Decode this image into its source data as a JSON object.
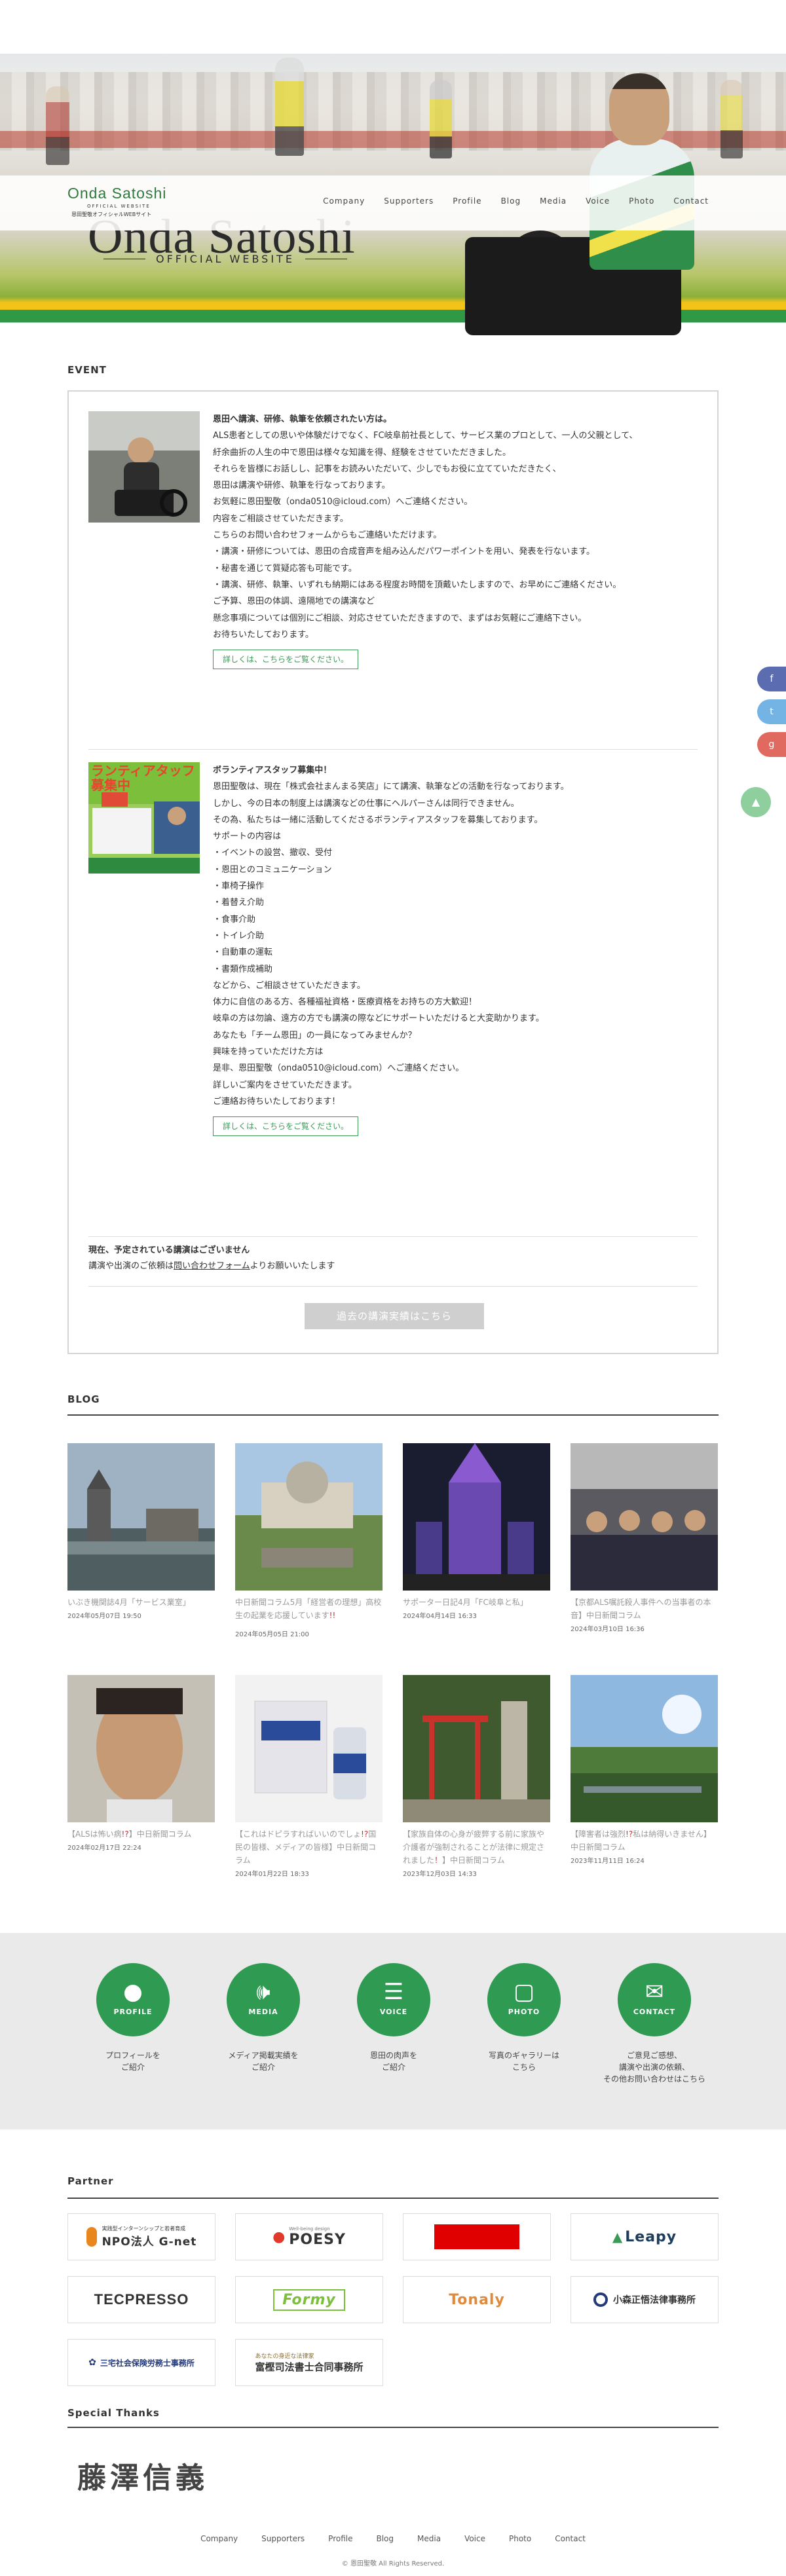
{
  "header": {
    "logo_name": "Onda Satoshi",
    "logo_sub": "OFFICIAL WEBSITE",
    "logo_jp": "恩田聖敬オフィシャルWEBサイト",
    "nav": [
      "Company",
      "Supporters",
      "Profile",
      "Blog",
      "Media",
      "Voice",
      "Photo",
      "Contact"
    ]
  },
  "hero": {
    "title": "Onda Satoshi",
    "subtitle": "OFFICIAL WEBSITE"
  },
  "event": {
    "section_title": "EVENT",
    "item1": {
      "lines": [
        "恩田へ講演、研修、執筆を依頼されたい方は。",
        "ALS患者としての思いや体験だけでなく、FC岐阜前社長として、サービス業のプロとして、一人の父親として、",
        "紆余曲折の人生の中で恩田は様々な知識を得、経験をさせていただきました。",
        "",
        "それらを皆様にお話しし、記事をお読みいただいて、少しでもお役に立てていただきたく、",
        "恩田は講演や研修、執筆を行なっております。",
        "",
        "お気軽に恩田聖敬（onda0510@icloud.com）へご連絡ください。",
        "内容をご相談させていただきます。",
        "こちらのお問い合わせフォームからもご連絡いただけます。",
        "",
        "・講演・研修については、恩田の合成音声を組み込んだパワーポイントを用い、発表を行ないます。",
        "・秘書を通じて質疑応答も可能です。",
        "・講演、研修、執筆、いずれも納期にはある程度お時間を頂戴いたしますので、お早めにご連絡ください。",
        "",
        "ご予算、恩田の体調、遠隔地での講演など",
        "懸念事項については個別にご相談、対応させていただきますので、まずはお気軽にご連絡下さい。",
        "お待ちいたしております。"
      ],
      "more": "詳しくは、こちらをご覧ください。"
    },
    "item2": {
      "lines": [
        "ボランティアスタッフ募集中！",
        "恩田聖敬は、現在「株式会社まんまる笑店」にて講演、執筆などの活動を行なっております。",
        "しかし、今の日本の制度上は講演などの仕事にヘルパーさんは同行できません。",
        "",
        "その為、私たちは一緒に活動してくださるボランティアスタッフを募集しております。",
        "",
        "サポートの内容は",
        "・イベントの設営、撤収、受付",
        "・恩田とのコミュニケーション",
        "・車椅子操作",
        "・着替え介助",
        "・食事介助",
        "・トイレ介助",
        "・自動車の運転",
        "・書類作成補助",
        "などから、ご相談させていただきます。",
        "",
        "体力に自信のある方、各種福祉資格・医療資格をお持ちの方大歓迎！",
        "岐阜の方は勿論、遠方の方でも講演の際などにサポートいただけると大変助かります。",
        "",
        "あなたも「チーム恩田」の一員になってみませんか？",
        "",
        "興味を持っていただけた方は",
        "是非、恩田聖敬（onda0510@icloud.com）へご連絡ください。",
        "詳しいご案内をさせていただきます。",
        "ご連絡お待ちいたしております！"
      ],
      "more": "詳しくは、こちらをご覧ください。",
      "poster_text": "ランティアタッフ募集中"
    },
    "notice_title": "現在、予定されている講演はございません",
    "notice_body_pre": "講演や出演のご依頼は",
    "notice_link": "問い合わせフォーム",
    "notice_body_post": "よりお願いいたします",
    "past_button": "過去の講演実績はこちら"
  },
  "blog": {
    "section_title": "BLOG",
    "posts": [
      {
        "title": "いぶき機関誌4月「サービス業室」",
        "date": "2024年05月07日 19:50"
      },
      {
        "title": "中日新聞コラム5月「経営者の理想」高校生の起業を応援しています",
        "title_em": "!!",
        "date": "2024年05月05日 21:00"
      },
      {
        "title": "サポーター日記4月「FC岐阜と私」",
        "date": "2024年04月14日 16:33"
      },
      {
        "title": "【京都ALS嘱託殺人事件への当事者の本音】中日新聞コラム",
        "date": "2024年03月10日 16:36"
      },
      {
        "title": "【ALSは怖い病",
        "title_em": "!?",
        "title_post": "】中日新聞コラム",
        "date": "2024年02月17日 22:24"
      },
      {
        "title": "【これはドピラすればいいのでしょ",
        "title_em": "!?",
        "title_post": "国民の皆様、メディアの皆様】中日新聞コラム",
        "date": "2024年01月22日 18:33"
      },
      {
        "title": "【家族自体の心身が疲弊する前に家族や介護者が強制されることが法律に規定されました",
        "title_em": "！",
        "title_post": "】中日新聞コラム",
        "date": "2023年12月03日 14:33"
      },
      {
        "title": "【障害者は強烈",
        "title_em": "!?",
        "title_post": "私は納得いきません】中日新聞コラム",
        "date": "2023年11月11日 16:24"
      }
    ]
  },
  "band": {
    "items": [
      {
        "icon": "profile-icon",
        "label": "PROFILE",
        "text": "プロフィールを\nご紹介"
      },
      {
        "icon": "media-icon",
        "label": "MEDIA",
        "text": "メディア掲載実績を\nご紹介"
      },
      {
        "icon": "voice-icon",
        "label": "VOICE",
        "text": "恩田の肉声を\nご紹介"
      },
      {
        "icon": "photo-icon",
        "label": "PHOTO",
        "text": "写真のギャラリーは\nこちら"
      },
      {
        "icon": "contact-icon",
        "label": "CONTACT",
        "text": "ご意見ご感想、\n講演や出演の依頼、\nその他お問い合わせはこちら"
      }
    ]
  },
  "partner": {
    "section_title": "Partner",
    "logos": [
      {
        "name": "NPO法人 G-net",
        "small": "実践型インターンシップと若者育成",
        "color": "#222"
      },
      {
        "name": "POESY",
        "small": "Well-being design",
        "color": "#222"
      },
      {
        "name": "",
        "small": "",
        "color": "#e00000"
      },
      {
        "name": "Leapy",
        "small": "",
        "color": "#1e3d5c"
      },
      {
        "name": "TECPRESSO",
        "small": "",
        "color": "#111"
      },
      {
        "name": "Formy",
        "small": "",
        "color": "#7bbf3a"
      },
      {
        "name": "Tonaly",
        "small": "",
        "color": "#e08a3a"
      },
      {
        "name": "小森正悟法律事務所",
        "small": "",
        "color": "#333"
      },
      {
        "name": "三宅社会保険労務士事務所",
        "small": "",
        "color": "#23397a"
      },
      {
        "name": "富樫司法書士合同事務所",
        "small": "あなたの身近な法律家",
        "color": "#333"
      }
    ]
  },
  "special": {
    "section_title": "Special Thanks",
    "name": "藤澤信義"
  },
  "footer": {
    "nav": [
      "Company",
      "Supporters",
      "Profile",
      "Blog",
      "Media",
      "Voice",
      "Photo",
      "Contact"
    ],
    "copyright": "© 恩田聖敬 All Rights Reserved."
  },
  "colors": {
    "brand_green": "#2e9a52",
    "link_blue": "#2b3ea8",
    "accent_red": "#c3323a"
  }
}
